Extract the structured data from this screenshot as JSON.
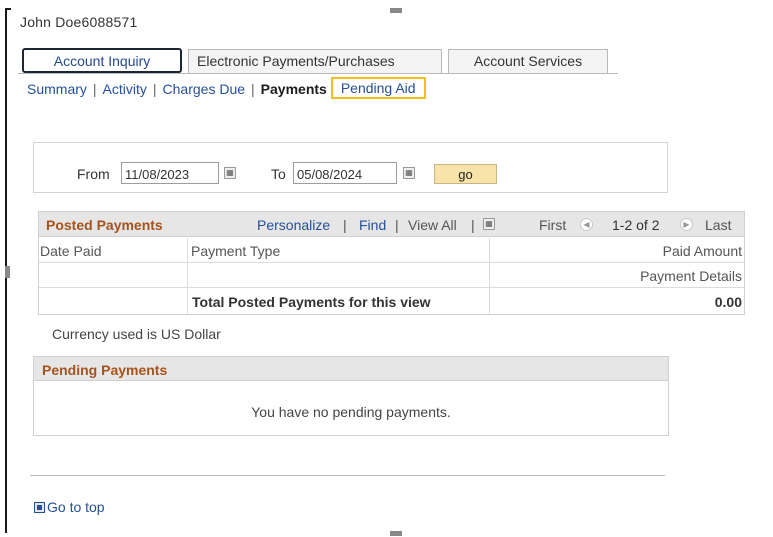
{
  "user": {
    "name": "John Doe6088571"
  },
  "tabs": [
    {
      "label": "Account Inquiry",
      "active": true
    },
    {
      "label": "Electronic Payments/Purchases",
      "active": false
    },
    {
      "label": "Account Services",
      "active": false
    }
  ],
  "subnav": {
    "items": [
      {
        "label": "Summary",
        "state": "link"
      },
      {
        "label": "Activity",
        "state": "link"
      },
      {
        "label": "Charges Due",
        "state": "link"
      },
      {
        "label": "Payments",
        "state": "current"
      },
      {
        "label": "Pending Aid",
        "state": "highlighted"
      }
    ],
    "separator": "|"
  },
  "date_filter": {
    "from_label": "From",
    "from_value": "11/08/2023",
    "to_label": "To",
    "to_value": "05/08/2024",
    "go_label": "go"
  },
  "posted_payments": {
    "title": "Posted Payments",
    "personalize": "Personalize",
    "find": "Find",
    "view_all": "View All",
    "first": "First",
    "range": "1-2 of 2",
    "last": "Last",
    "columns": {
      "date_paid": "Date Paid",
      "payment_type": "Payment Type",
      "paid_amount": "Paid Amount"
    },
    "details_link": "Payment Details",
    "total_label": "Total Posted Payments for this view",
    "total_value": "0.00"
  },
  "currency_note": "Currency used is US Dollar",
  "pending_payments": {
    "title": "Pending Payments",
    "message": "You have no pending payments."
  },
  "footer": {
    "go_to_top": "Go to top"
  },
  "colors": {
    "link": "#24509a",
    "section_title": "#a5531c",
    "highlight_border": "#f2c01c",
    "go_button": "#f8e3a8"
  }
}
